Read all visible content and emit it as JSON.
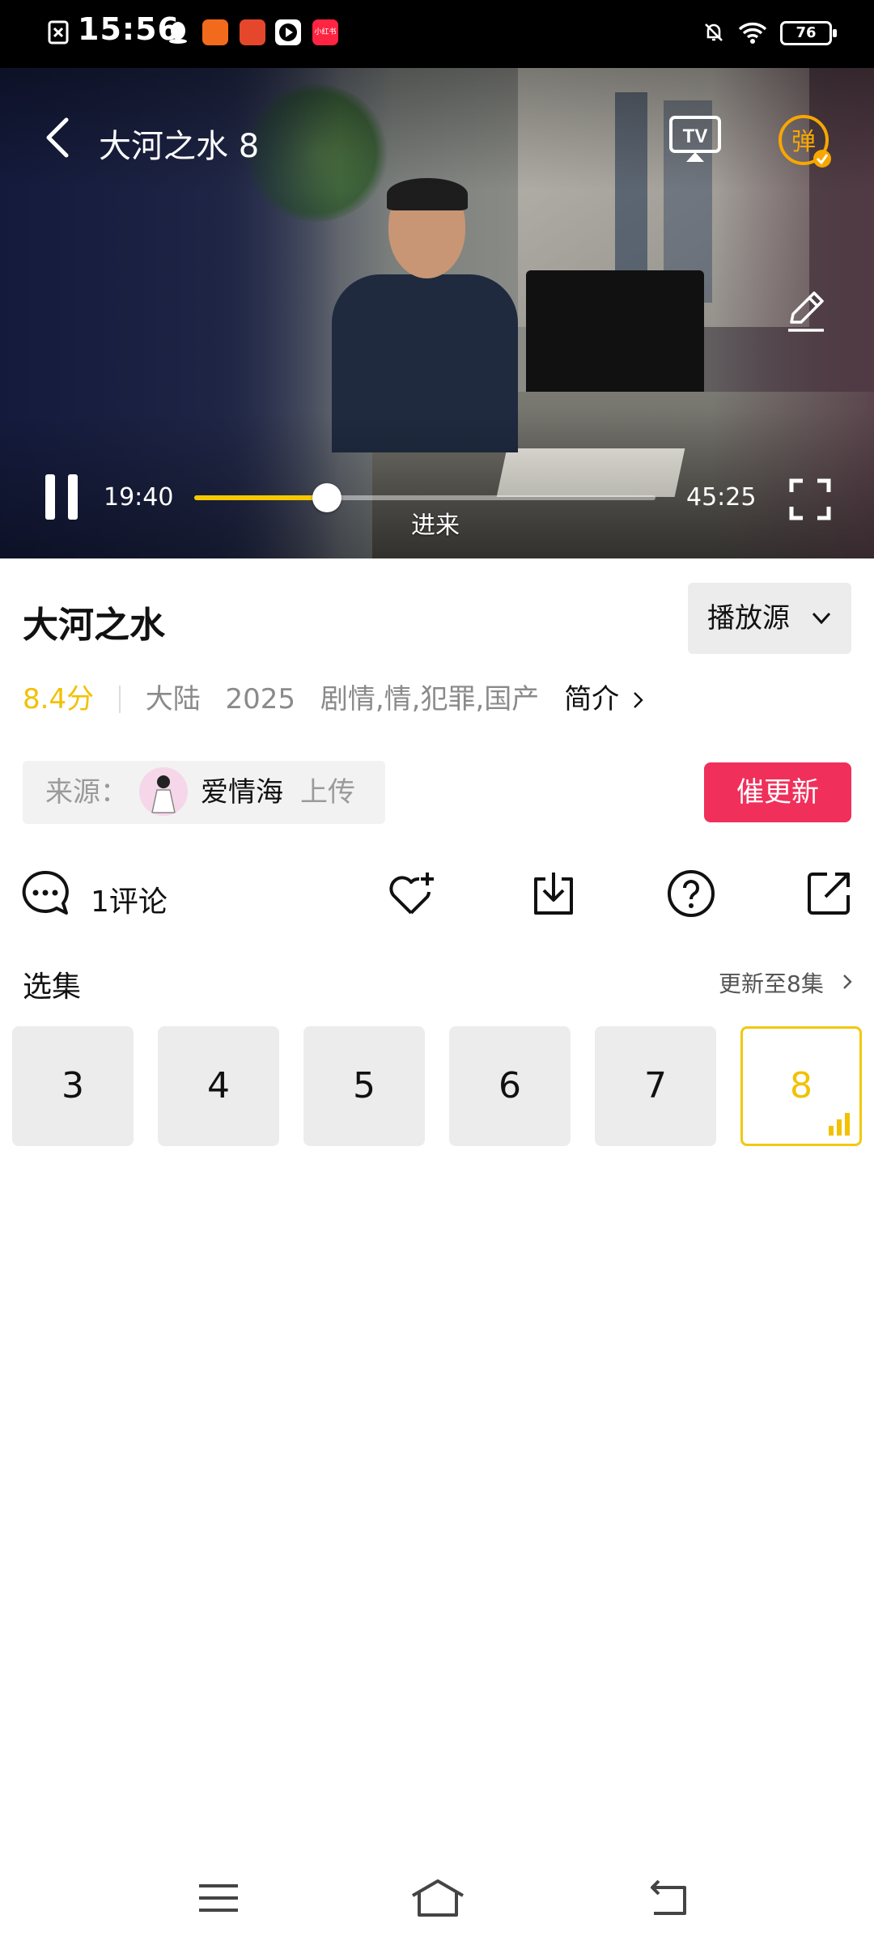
{
  "status_bar": {
    "time": "15:56",
    "battery": "76",
    "icons": [
      "sim-card-icon",
      "qq-icon",
      "app-icon",
      "game-icon",
      "video-icon",
      "xiaohongshu-icon",
      "mute-bell-icon",
      "wifi-icon",
      "battery-icon"
    ],
    "xiaohongshu_label": "小红书"
  },
  "player": {
    "title": "大河之水 8",
    "current_time": "19:40",
    "total_time": "45:25",
    "progress": 0.287,
    "subtitle": "进来",
    "tv_label": "TV",
    "danmaku_label": "弹",
    "accent_color": "#f7c800"
  },
  "info": {
    "title": "大河之水",
    "source_button": "播放源",
    "score": "8.4分",
    "region": "大陆",
    "year": "2025",
    "genres": "剧情,情,犯罪,国产",
    "intro": "简介"
  },
  "uploader": {
    "label": "来源：",
    "name": "爱情海",
    "suffix": "上传"
  },
  "urge_button": "催更新",
  "actions": {
    "comment_count": "1评论"
  },
  "episodes": {
    "heading": "选集",
    "update_text": "更新至8集",
    "items": [
      "3",
      "4",
      "5",
      "6",
      "7",
      "8"
    ],
    "active": "8",
    "active_color": "#f2c811"
  }
}
